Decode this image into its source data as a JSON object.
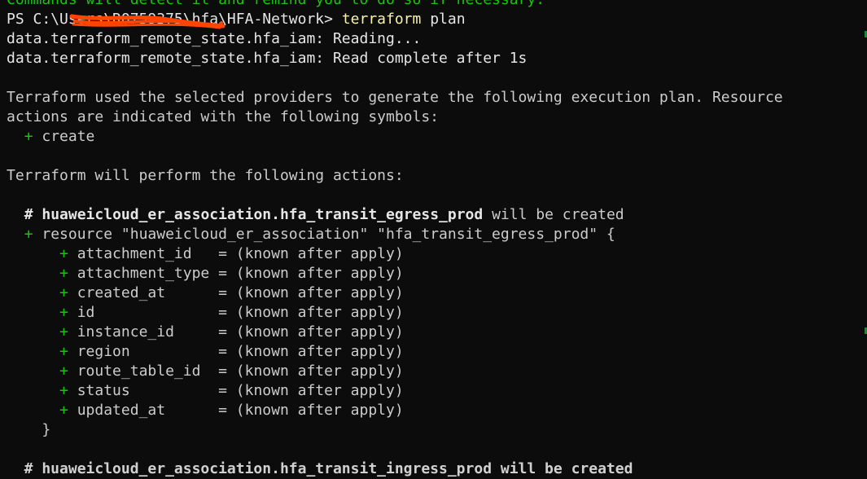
{
  "terminal": {
    "top_partial": "Commands will detect it and remind you to do so if necessary.",
    "prompt": {
      "prefix": "PS C:\\",
      "redacted": "Users\\RO759375",
      "path_rest": "\\hfa\\HFA-Network> ",
      "command": "terraform",
      "args": " plan"
    },
    "lines": [
      "data.terraform_remote_state.hfa_iam: Reading...",
      "data.terraform_remote_state.hfa_iam: Read complete after 1s",
      "",
      "Terraform used the selected providers to generate the following execution plan. Resource",
      "actions are indicated with the following symbols:"
    ],
    "symbol_line": {
      "symbol": "+",
      "label": " create"
    },
    "perform_line": "Terraform will perform the following actions:",
    "resource_comment": {
      "hash": "# ",
      "name": "huaweicloud_er_association.hfa_transit_egress_prod",
      "suffix": " will be created"
    },
    "resource_decl": {
      "plus": "+",
      "text": " resource \"huaweicloud_er_association\" \"hfa_transit_egress_prod\" {"
    },
    "attributes": [
      {
        "plus": "+",
        "text": " attachment_id   = (known after apply)"
      },
      {
        "plus": "+",
        "text": " attachment_type = (known after apply)"
      },
      {
        "plus": "+",
        "text": " created_at      = (known after apply)"
      },
      {
        "plus": "+",
        "text": " id              = (known after apply)"
      },
      {
        "plus": "+",
        "text": " instance_id     = (known after apply)"
      },
      {
        "plus": "+",
        "text": " region          = (known after apply)"
      },
      {
        "plus": "+",
        "text": " route_table_id  = (known after apply)"
      },
      {
        "plus": "+",
        "text": " status          = (known after apply)"
      },
      {
        "plus": "+",
        "text": " updated_at      = (known after apply)"
      }
    ],
    "closing_brace": "    }",
    "bottom_partial": "  # huaweicloud_er_association.hfa_transit_ingress_prod will be created"
  },
  "colors": {
    "background": "#0c0c0c",
    "text": "#cccccc",
    "green": "#16c60c",
    "command_yellow": "#f9f1a5",
    "redaction": "#ff4500"
  }
}
